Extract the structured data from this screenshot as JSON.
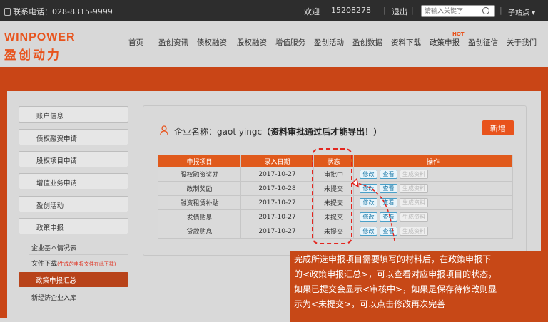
{
  "topbar": {
    "phone": "联系电话：028-8315-9999",
    "welcome": "欢迎",
    "user": "15208278",
    "sep": "|",
    "logout": "退出",
    "search_placeholder": "请输入关键字",
    "subsite": "子站点"
  },
  "logo": {
    "en": "WINPOWER",
    "cn": "盈创动力"
  },
  "nav": [
    "首页",
    "盈创资讯",
    "债权融资",
    "股权融资",
    "增值服务",
    "盈创活动",
    "盈创数据",
    "资料下载",
    "政策申报",
    "盈创征信",
    "关于我们"
  ],
  "nav_hot": "HOT",
  "sidebar": {
    "items": [
      "账户信息",
      "债权融资申请",
      "股权项目申请",
      "增值业务申请",
      "盈创活动",
      "政策申报"
    ],
    "sub": [
      "企业基本情况表",
      "文件下载",
      "政策申报汇总",
      "新经济企业入库"
    ],
    "sub_note": "(生成的申报文件在此下载)"
  },
  "panel": {
    "title_label": "企业名称：gaot yingc",
    "title_note": "（资料审批通过后才能导出！）",
    "add_button": "新增"
  },
  "table": {
    "headers": [
      "申报项目",
      "录入日期",
      "状态",
      "操作"
    ],
    "rows": [
      {
        "project": "股权融资奖励",
        "date": "2017-10-27",
        "status": "审批中"
      },
      {
        "project": "改制奖励",
        "date": "2017-10-28",
        "status": "未提交"
      },
      {
        "project": "融资租赁补贴",
        "date": "2017-10-27",
        "status": "未提交"
      },
      {
        "project": "发债贴息",
        "date": "2017-10-27",
        "status": "未提交"
      },
      {
        "project": "贷款贴息",
        "date": "2017-10-27",
        "status": "未提交"
      }
    ],
    "actions": {
      "edit": "修改",
      "view": "查看",
      "generate": "生成资料"
    }
  },
  "note": [
    "完成所选申报项目需要填写的材料后，在政策申报下",
    "的<政策申报汇总>，可以查看对应申报项目的状态，",
    "如果已提交会显示<审核中>，如果是保存待修改则显",
    "示为<未提交>，可以点击修改再次完善"
  ],
  "colors": {
    "accent": "#e8531c",
    "banner": "#c94516",
    "highlight": "#e3261f"
  }
}
